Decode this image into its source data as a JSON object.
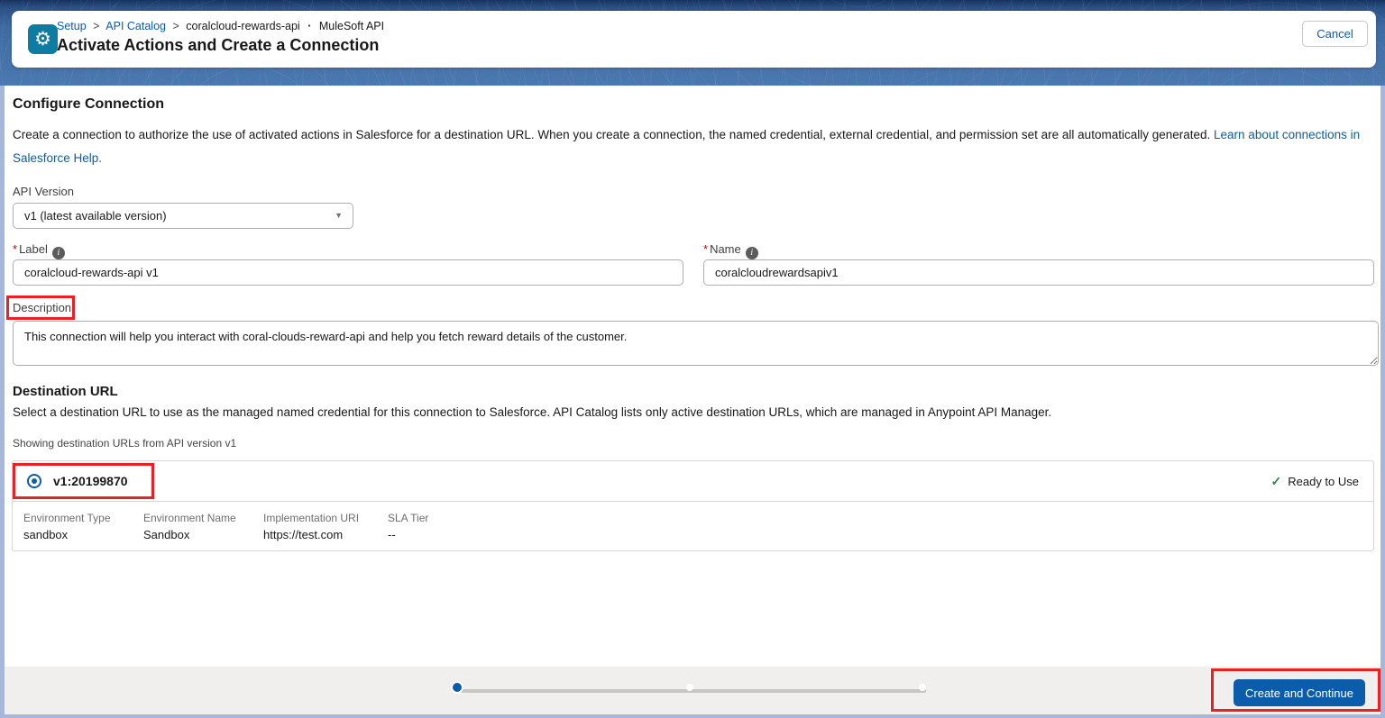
{
  "header": {
    "breadcrumb": {
      "setup": "Setup",
      "separator": ">",
      "api_catalog": "API Catalog",
      "current": "coralcloud-rewards-api",
      "dot": "·",
      "suffix": "MuleSoft API"
    },
    "title": "Activate Actions and Create a Connection",
    "cancel_label": "Cancel"
  },
  "main": {
    "section_title": "Configure Connection",
    "intro_text": "Create a connection to authorize the use of activated actions in Salesforce for a destination URL. When you create a connection, the named credential, external credential, and permission set are all automatically generated. ",
    "intro_link": "Learn about connections in Salesforce Help.",
    "required_marker": "*",
    "api_version": {
      "label": "API Version",
      "value": "v1 (latest available version)"
    },
    "label_field": {
      "label": "Label",
      "value": "coralcloud-rewards-api v1"
    },
    "name_field": {
      "label": "Name",
      "value": "coralcloudrewardsapiv1"
    },
    "description_field": {
      "label": "Description",
      "value": "This connection will help you interact with coral-clouds-reward-api and help you fetch reward details of the customer."
    },
    "destination": {
      "title": "Destination URL",
      "subtitle": "Select a destination URL to use as the managed named credential for this connection to Salesforce. API Catalog lists only active destination URLs, which are managed in Anypoint API Manager.",
      "showing": "Showing destination URLs from API version v1",
      "option": {
        "value": "v1:20199870",
        "status": "Ready to Use",
        "details": [
          {
            "label": "Environment Type",
            "value": "sandbox"
          },
          {
            "label": "Environment Name",
            "value": "Sandbox"
          },
          {
            "label": "Implementation URI",
            "value": "https://test.com"
          },
          {
            "label": "SLA Tier",
            "value": "--"
          }
        ]
      }
    }
  },
  "footer": {
    "continue_label": "Create and Continue",
    "steps_total": 3,
    "active_step": 1
  },
  "icons": {
    "gear": "⚙",
    "info": "i",
    "chevron_down": "▼",
    "check": "✓"
  },
  "colors": {
    "accent_blue": "#0b5cab",
    "gear_tile_teal": "#0e7ca2",
    "success_green": "#2e844a",
    "annotation_red": "#ec2024",
    "band_blue": "#4c78b0",
    "footer_gray": "#f0efee"
  }
}
